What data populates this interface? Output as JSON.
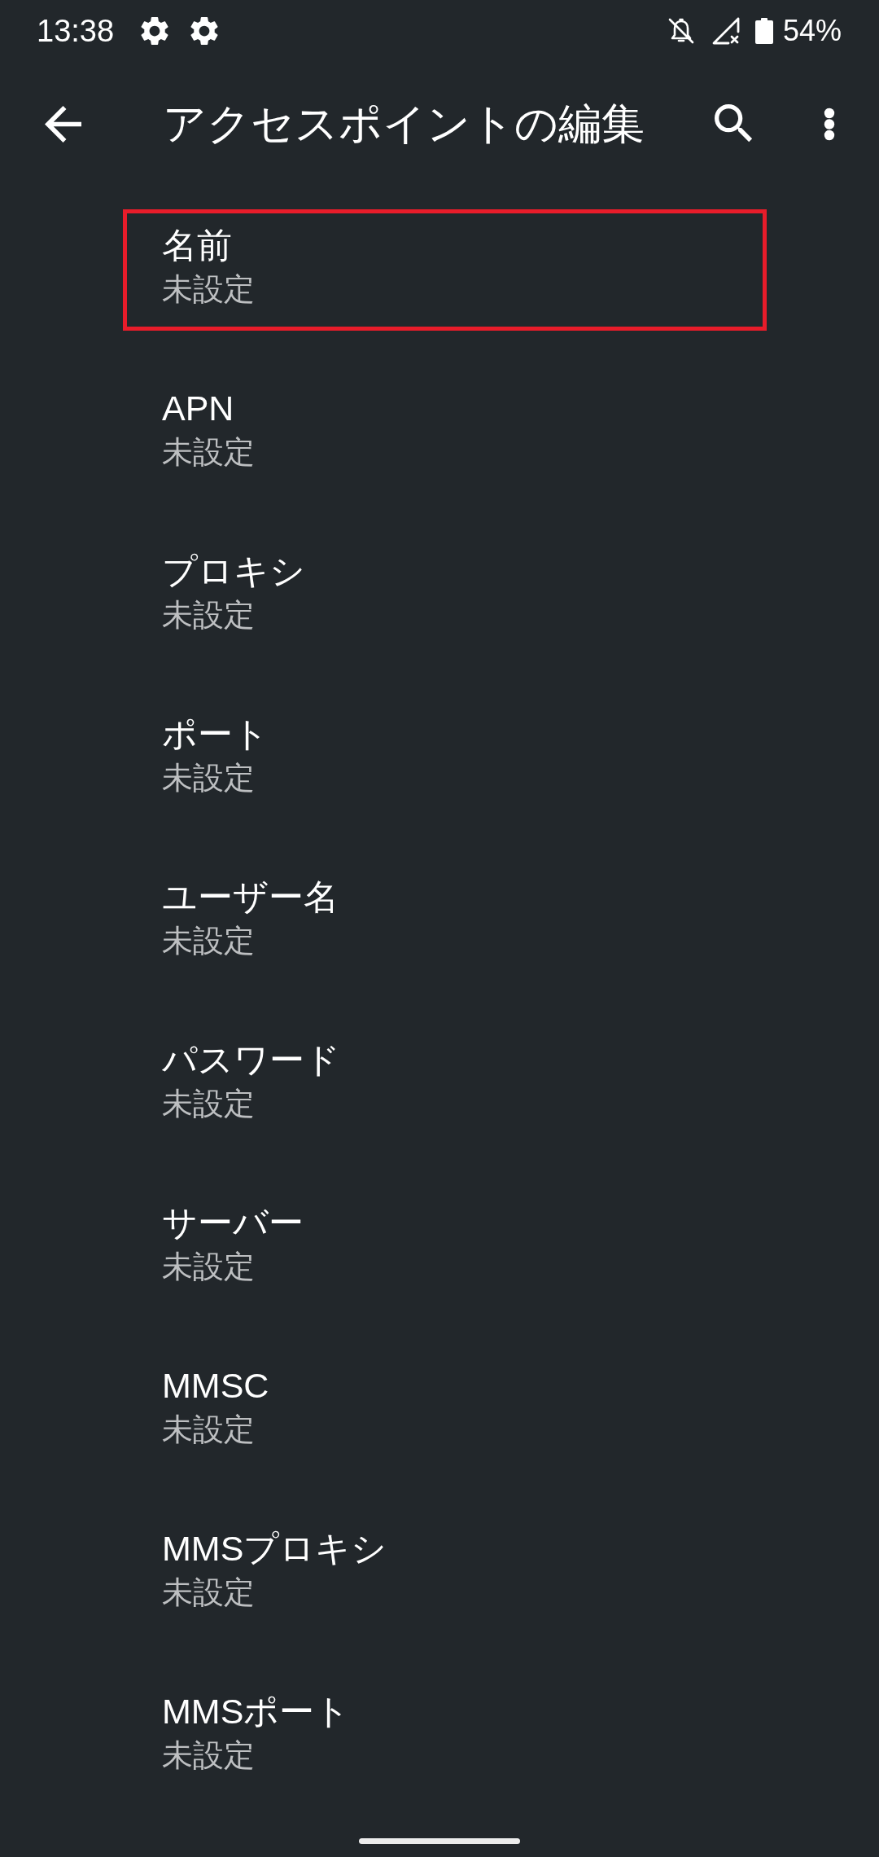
{
  "status_bar": {
    "time": "13:38",
    "battery": "54%"
  },
  "app_bar": {
    "title": "アクセスポイントの編集"
  },
  "items": [
    {
      "title": "名前",
      "value": "未設定",
      "highlighted": true
    },
    {
      "title": "APN",
      "value": "未設定",
      "highlighted": false
    },
    {
      "title": "プロキシ",
      "value": "未設定",
      "highlighted": false
    },
    {
      "title": "ポート",
      "value": "未設定",
      "highlighted": false
    },
    {
      "title": "ユーザー名",
      "value": "未設定",
      "highlighted": false
    },
    {
      "title": "パスワード",
      "value": "未設定",
      "highlighted": false
    },
    {
      "title": "サーバー",
      "value": "未設定",
      "highlighted": false
    },
    {
      "title": "MMSC",
      "value": "未設定",
      "highlighted": false
    },
    {
      "title": "MMSプロキシ",
      "value": "未設定",
      "highlighted": false
    },
    {
      "title": "MMSポート",
      "value": "未設定",
      "highlighted": false
    }
  ]
}
